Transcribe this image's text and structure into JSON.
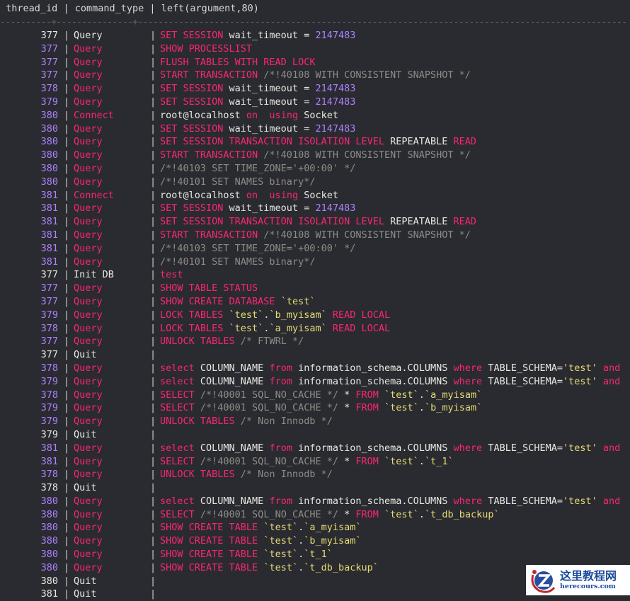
{
  "header": {
    "thread_id": "thread_id",
    "command_type": "command_type",
    "argument": "left(argument,80)",
    "separator": "----------+---------------+------------------------------------------------------------------------------------------------"
  },
  "pipe": "|",
  "rows": [
    {
      "id": "377",
      "cmd": "Query",
      "hl": false,
      "arg": [
        [
          "k",
          "SET SESSION"
        ],
        [
          "t",
          " wait_timeout = "
        ],
        [
          "n",
          "2147483"
        ]
      ]
    },
    {
      "id": "377",
      "cmd": "Query",
      "hl": true,
      "arg": [
        [
          "k",
          "SHOW PROCESSLIST"
        ]
      ]
    },
    {
      "id": "377",
      "cmd": "Query",
      "hl": true,
      "arg": [
        [
          "k",
          "FLUSH TABLES WITH READ LOCK"
        ]
      ]
    },
    {
      "id": "377",
      "cmd": "Query",
      "hl": true,
      "arg": [
        [
          "k",
          "START TRANSACTION"
        ],
        [
          "c",
          " /*!40108 WITH CONSISTENT SNAPSHOT */"
        ]
      ]
    },
    {
      "id": "378",
      "cmd": "Query",
      "hl": true,
      "arg": [
        [
          "k",
          "SET SESSION"
        ],
        [
          "t",
          " wait_timeout = "
        ],
        [
          "n",
          "2147483"
        ]
      ]
    },
    {
      "id": "379",
      "cmd": "Query",
      "hl": true,
      "arg": [
        [
          "k",
          "SET SESSION"
        ],
        [
          "t",
          " wait_timeout = "
        ],
        [
          "n",
          "2147483"
        ]
      ]
    },
    {
      "id": "380",
      "cmd": "Connect",
      "hl": true,
      "arg": [
        [
          "t",
          "root@localhost "
        ],
        [
          "k",
          "on  using"
        ],
        [
          "t",
          " Socket"
        ]
      ]
    },
    {
      "id": "380",
      "cmd": "Query",
      "hl": true,
      "arg": [
        [
          "k",
          "SET SESSION"
        ],
        [
          "t",
          " wait_timeout = "
        ],
        [
          "n",
          "2147483"
        ]
      ]
    },
    {
      "id": "380",
      "cmd": "Query",
      "hl": true,
      "arg": [
        [
          "k",
          "SET SESSION TRANSACTION ISOLATION LEVEL"
        ],
        [
          "t",
          " REPEATABLE "
        ],
        [
          "k",
          "READ"
        ]
      ]
    },
    {
      "id": "380",
      "cmd": "Query",
      "hl": true,
      "arg": [
        [
          "k",
          "START TRANSACTION"
        ],
        [
          "c",
          " /*!40108 WITH CONSISTENT SNAPSHOT */"
        ]
      ]
    },
    {
      "id": "380",
      "cmd": "Query",
      "hl": true,
      "arg": [
        [
          "c",
          "/*!40103 SET TIME_ZONE='+00:00' */"
        ]
      ]
    },
    {
      "id": "380",
      "cmd": "Query",
      "hl": true,
      "arg": [
        [
          "c",
          "/*!40101 SET NAMES binary*/"
        ]
      ]
    },
    {
      "id": "381",
      "cmd": "Connect",
      "hl": true,
      "arg": [
        [
          "t",
          "root@localhost "
        ],
        [
          "k",
          "on  using"
        ],
        [
          "t",
          " Socket"
        ]
      ]
    },
    {
      "id": "381",
      "cmd": "Query",
      "hl": true,
      "arg": [
        [
          "k",
          "SET SESSION"
        ],
        [
          "t",
          " wait_timeout = "
        ],
        [
          "n",
          "2147483"
        ]
      ]
    },
    {
      "id": "381",
      "cmd": "Query",
      "hl": true,
      "arg": [
        [
          "k",
          "SET SESSION TRANSACTION ISOLATION LEVEL"
        ],
        [
          "t",
          " REPEATABLE "
        ],
        [
          "k",
          "READ"
        ]
      ]
    },
    {
      "id": "381",
      "cmd": "Query",
      "hl": true,
      "arg": [
        [
          "k",
          "START TRANSACTION"
        ],
        [
          "c",
          " /*!40108 WITH CONSISTENT SNAPSHOT */"
        ]
      ]
    },
    {
      "id": "381",
      "cmd": "Query",
      "hl": true,
      "arg": [
        [
          "c",
          "/*!40103 SET TIME_ZONE='+00:00' */"
        ]
      ]
    },
    {
      "id": "381",
      "cmd": "Query",
      "hl": true,
      "arg": [
        [
          "c",
          "/*!40101 SET NAMES binary*/"
        ]
      ]
    },
    {
      "id": "377",
      "cmd": "Init DB",
      "hl": false,
      "arg": [
        [
          "k",
          "test"
        ]
      ]
    },
    {
      "id": "377",
      "cmd": "Query",
      "hl": true,
      "arg": [
        [
          "k",
          "SHOW TABLE STATUS"
        ]
      ]
    },
    {
      "id": "377",
      "cmd": "Query",
      "hl": true,
      "arg": [
        [
          "k",
          "SHOW CREATE DATABASE "
        ],
        [
          "s",
          "`test`"
        ]
      ]
    },
    {
      "id": "379",
      "cmd": "Query",
      "hl": true,
      "arg": [
        [
          "k",
          "LOCK TABLES "
        ],
        [
          "s",
          "`test`"
        ],
        [
          "t",
          "."
        ],
        [
          "s",
          "`b_myisam`"
        ],
        [
          "k",
          " READ LOCAL"
        ]
      ]
    },
    {
      "id": "378",
      "cmd": "Query",
      "hl": true,
      "arg": [
        [
          "k",
          "LOCK TABLES "
        ],
        [
          "s",
          "`test`"
        ],
        [
          "t",
          "."
        ],
        [
          "s",
          "`a_myisam`"
        ],
        [
          "k",
          " READ LOCAL"
        ]
      ]
    },
    {
      "id": "377",
      "cmd": "Query",
      "hl": true,
      "arg": [
        [
          "k",
          "UNLOCK TABLES"
        ],
        [
          "c",
          " /* FTWRL */"
        ]
      ]
    },
    {
      "id": "377",
      "cmd": "Quit",
      "hl": false,
      "arg": []
    },
    {
      "id": "378",
      "cmd": "Query",
      "hl": true,
      "arg": [
        [
          "k",
          "select"
        ],
        [
          "t",
          " COLUMN_NAME "
        ],
        [
          "k",
          "from"
        ],
        [
          "t",
          " information_schema.COLUMNS "
        ],
        [
          "k",
          "where"
        ],
        [
          "t",
          " TABLE_SCHEMA="
        ],
        [
          "s",
          "'test'"
        ],
        [
          "k",
          " and"
        ]
      ]
    },
    {
      "id": "379",
      "cmd": "Query",
      "hl": true,
      "arg": [
        [
          "k",
          "select"
        ],
        [
          "t",
          " COLUMN_NAME "
        ],
        [
          "k",
          "from"
        ],
        [
          "t",
          " information_schema.COLUMNS "
        ],
        [
          "k",
          "where"
        ],
        [
          "t",
          " TABLE_SCHEMA="
        ],
        [
          "s",
          "'test'"
        ],
        [
          "k",
          " and"
        ]
      ]
    },
    {
      "id": "378",
      "cmd": "Query",
      "hl": true,
      "arg": [
        [
          "k",
          "SELECT"
        ],
        [
          "c",
          " /*!40001 SQL_NO_CACHE */"
        ],
        [
          "t",
          " * "
        ],
        [
          "k",
          "FROM "
        ],
        [
          "s",
          "`test`"
        ],
        [
          "t",
          "."
        ],
        [
          "s",
          "`a_myisam`"
        ]
      ]
    },
    {
      "id": "379",
      "cmd": "Query",
      "hl": true,
      "arg": [
        [
          "k",
          "SELECT"
        ],
        [
          "c",
          " /*!40001 SQL_NO_CACHE */"
        ],
        [
          "t",
          " * "
        ],
        [
          "k",
          "FROM "
        ],
        [
          "s",
          "`test`"
        ],
        [
          "t",
          "."
        ],
        [
          "s",
          "`b_myisam`"
        ]
      ]
    },
    {
      "id": "379",
      "cmd": "Query",
      "hl": true,
      "arg": [
        [
          "k",
          "UNLOCK TABLES"
        ],
        [
          "c",
          " /* Non Innodb */"
        ]
      ]
    },
    {
      "id": "379",
      "cmd": "Quit",
      "hl": false,
      "arg": []
    },
    {
      "id": "381",
      "cmd": "Query",
      "hl": true,
      "arg": [
        [
          "k",
          "select"
        ],
        [
          "t",
          " COLUMN_NAME "
        ],
        [
          "k",
          "from"
        ],
        [
          "t",
          " information_schema.COLUMNS "
        ],
        [
          "k",
          "where"
        ],
        [
          "t",
          " TABLE_SCHEMA="
        ],
        [
          "s",
          "'test'"
        ],
        [
          "k",
          " and"
        ]
      ]
    },
    {
      "id": "381",
      "cmd": "Query",
      "hl": true,
      "arg": [
        [
          "k",
          "SELECT"
        ],
        [
          "c",
          " /*!40001 SQL_NO_CACHE */"
        ],
        [
          "t",
          " * "
        ],
        [
          "k",
          "FROM "
        ],
        [
          "s",
          "`test`"
        ],
        [
          "t",
          "."
        ],
        [
          "s",
          "`t_1`"
        ]
      ]
    },
    {
      "id": "378",
      "cmd": "Query",
      "hl": true,
      "arg": [
        [
          "k",
          "UNLOCK TABLES"
        ],
        [
          "c",
          " /* Non Innodb */"
        ]
      ]
    },
    {
      "id": "378",
      "cmd": "Quit",
      "hl": false,
      "arg": []
    },
    {
      "id": "380",
      "cmd": "Query",
      "hl": true,
      "arg": [
        [
          "k",
          "select"
        ],
        [
          "t",
          " COLUMN_NAME "
        ],
        [
          "k",
          "from"
        ],
        [
          "t",
          " information_schema.COLUMNS "
        ],
        [
          "k",
          "where"
        ],
        [
          "t",
          " TABLE_SCHEMA="
        ],
        [
          "s",
          "'test'"
        ],
        [
          "k",
          " and"
        ]
      ]
    },
    {
      "id": "380",
      "cmd": "Query",
      "hl": true,
      "arg": [
        [
          "k",
          "SELECT"
        ],
        [
          "c",
          " /*!40001 SQL_NO_CACHE */"
        ],
        [
          "t",
          " * "
        ],
        [
          "k",
          "FROM "
        ],
        [
          "s",
          "`test`"
        ],
        [
          "t",
          "."
        ],
        [
          "s",
          "`t_db_backup`"
        ]
      ]
    },
    {
      "id": "380",
      "cmd": "Query",
      "hl": true,
      "arg": [
        [
          "k",
          "SHOW CREATE TABLE "
        ],
        [
          "s",
          "`test`"
        ],
        [
          "t",
          "."
        ],
        [
          "s",
          "`a_myisam`"
        ]
      ]
    },
    {
      "id": "380",
      "cmd": "Query",
      "hl": true,
      "arg": [
        [
          "k",
          "SHOW CREATE TABLE "
        ],
        [
          "s",
          "`test`"
        ],
        [
          "t",
          "."
        ],
        [
          "s",
          "`b_myisam`"
        ]
      ]
    },
    {
      "id": "380",
      "cmd": "Query",
      "hl": true,
      "arg": [
        [
          "k",
          "SHOW CREATE TABLE "
        ],
        [
          "s",
          "`test`"
        ],
        [
          "t",
          "."
        ],
        [
          "s",
          "`t_1`"
        ]
      ]
    },
    {
      "id": "380",
      "cmd": "Query",
      "hl": true,
      "arg": [
        [
          "k",
          "SHOW CREATE TABLE "
        ],
        [
          "s",
          "`test`"
        ],
        [
          "t",
          "."
        ],
        [
          "s",
          "`t_db_backup`"
        ]
      ]
    },
    {
      "id": "380",
      "cmd": "Quit",
      "hl": false,
      "arg": []
    },
    {
      "id": "381",
      "cmd": "Quit",
      "hl": false,
      "arg": []
    }
  ],
  "watermark": {
    "cn": "这里教程网",
    "en": "herecours.com"
  },
  "colors": {
    "bg": "#2a2b30",
    "keyword": "#f92672",
    "number": "#ae81ff",
    "string": "#e6db74",
    "comment": "#8c8c86"
  }
}
